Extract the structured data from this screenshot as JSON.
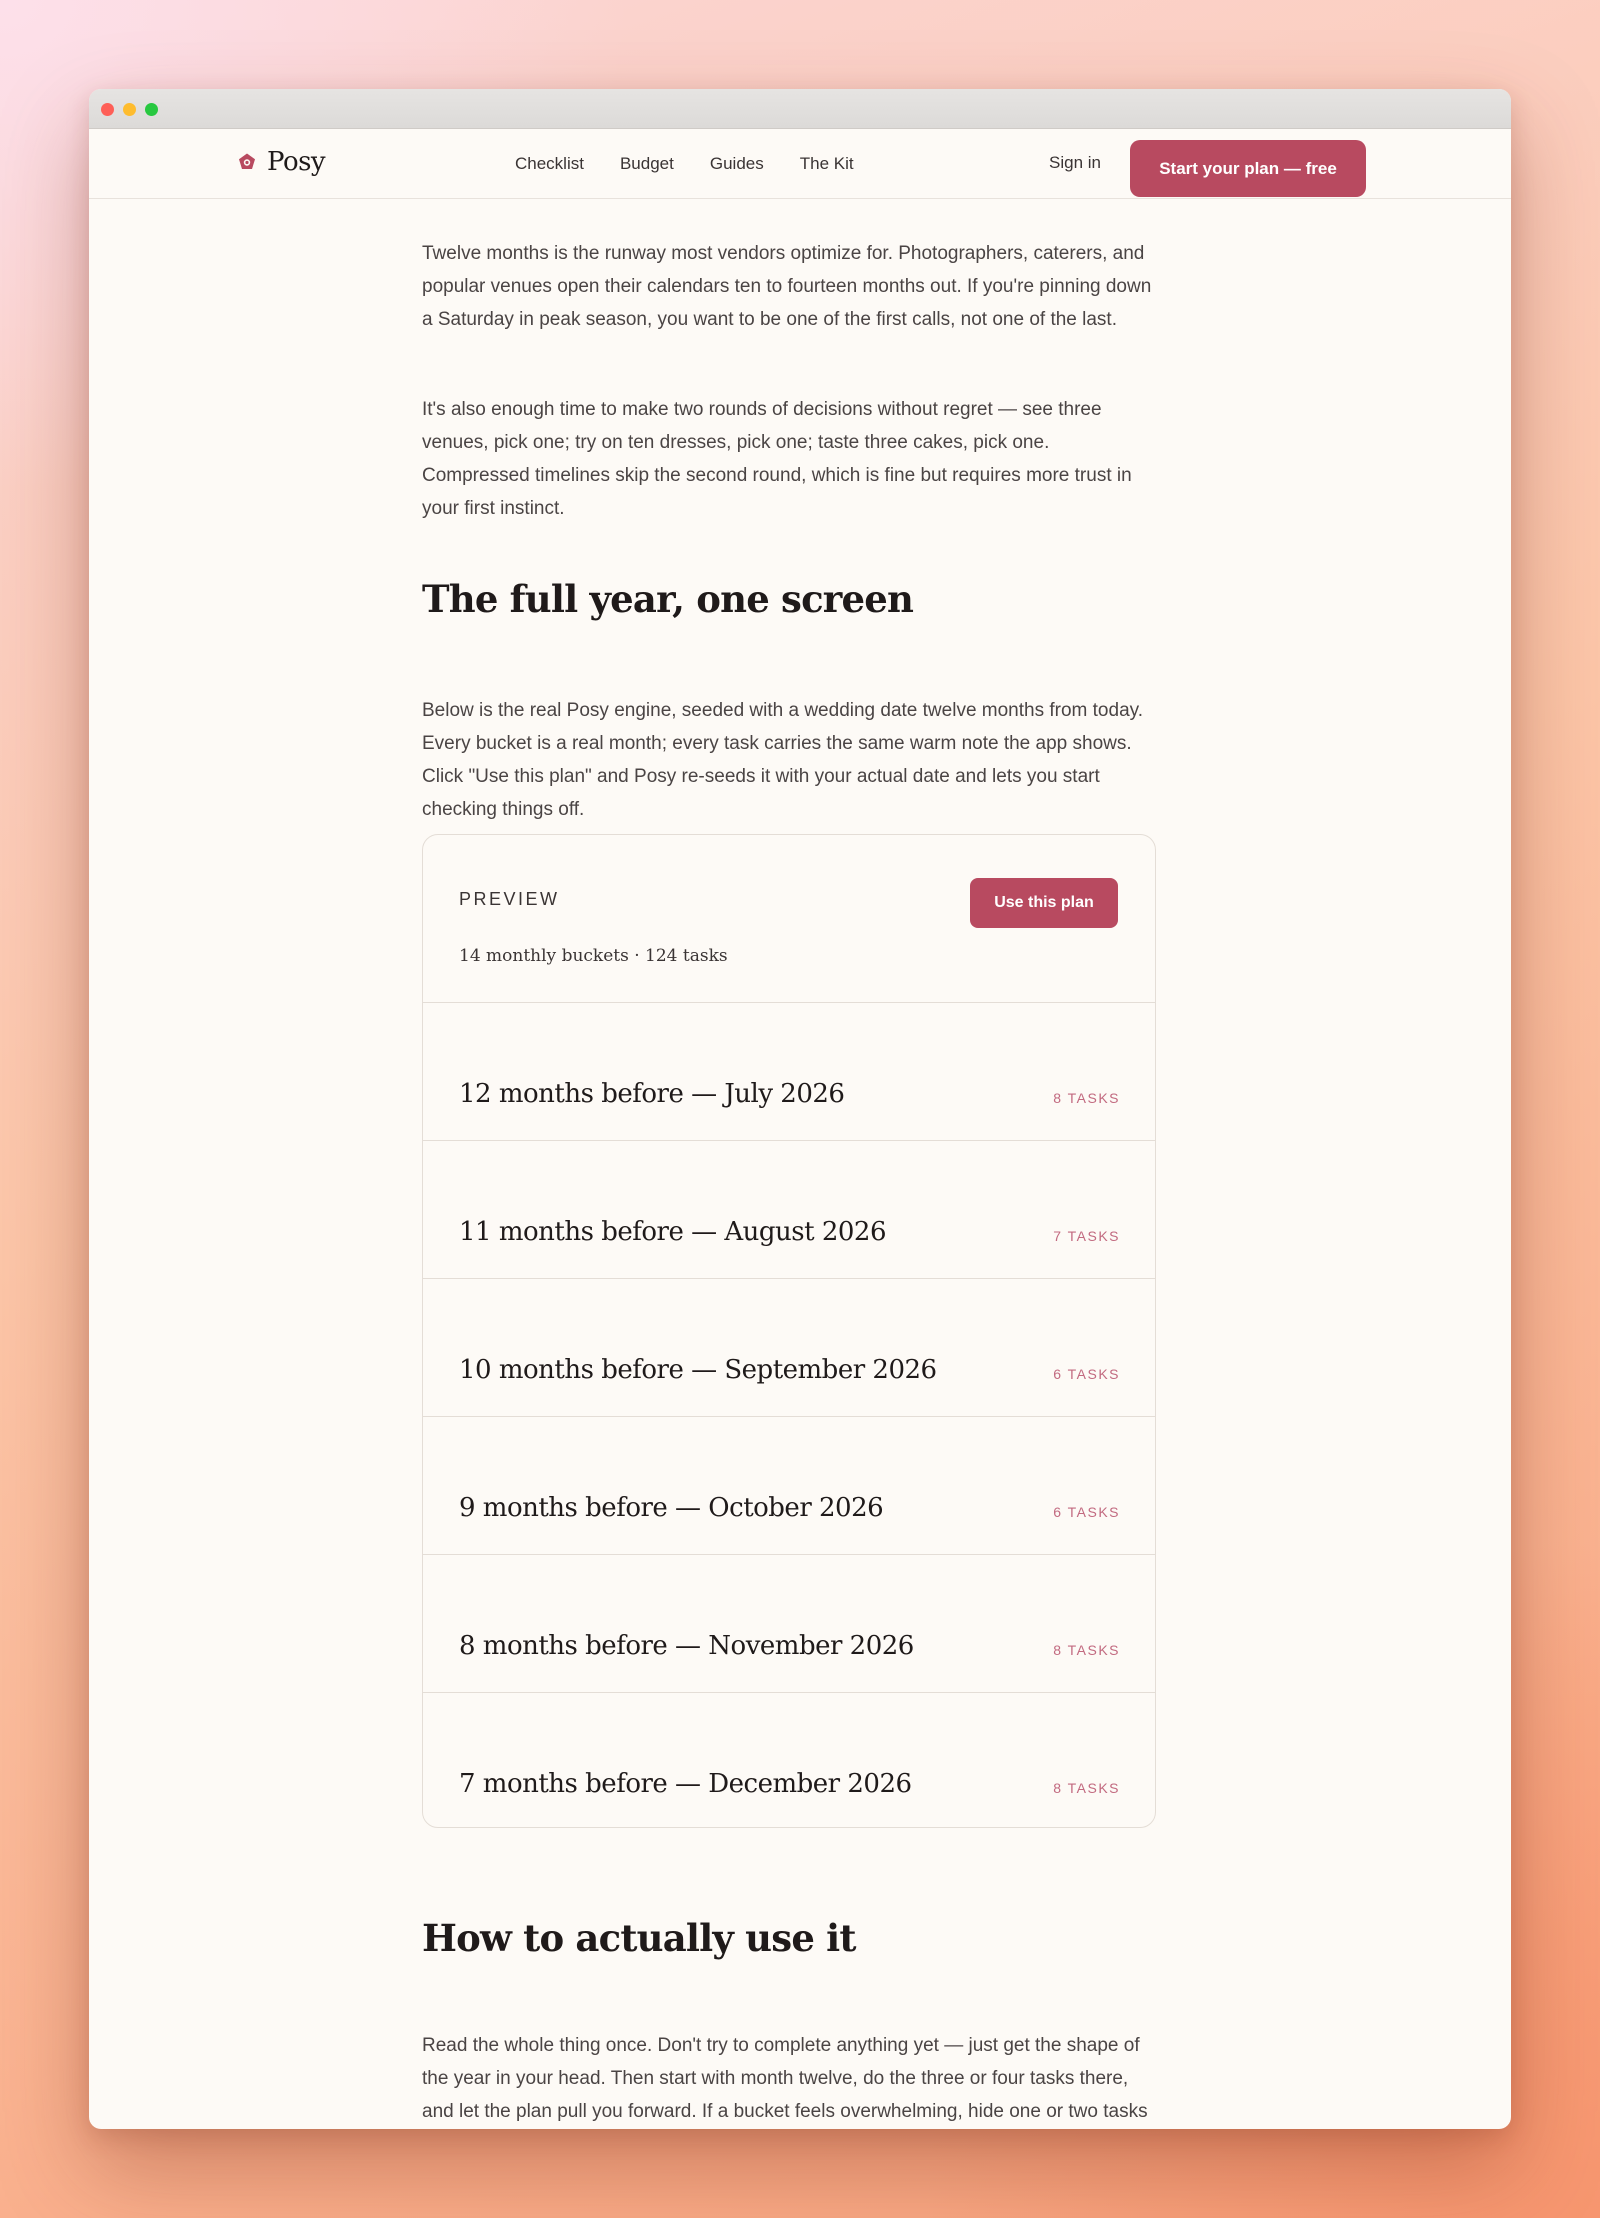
{
  "nav": {
    "brand": "Posy",
    "links": [
      "Checklist",
      "Budget",
      "Guides",
      "The Kit"
    ],
    "sign_in": "Sign in",
    "cta": "Start your plan — free"
  },
  "article": {
    "intro_p1": "Twelve months is the runway most vendors optimize for. Photographers, caterers, and popular venues open their calendars ten to fourteen months out. If you're pinning down a Saturday in peak season, you want to be one of the first calls, not one of the last.",
    "intro_p2": "It's also enough time to make two rounds of decisions without regret — see three venues, pick one; try on ten dresses, pick one; taste three cakes, pick one. Compressed timelines skip the second round, which is fine but requires more trust in your first instinct.",
    "section1_title": "The full year, one screen",
    "section1_p": "Below is the real Posy engine, seeded with a wedding date twelve months from today. Every bucket is a real month; every task carries the same warm note the app shows. Click \"Use this plan\" and Posy re-seeds it with your actual date and lets you start checking things off.",
    "section2_title": "How to actually use it",
    "section2_p": "Read the whole thing once. Don't try to complete anything yet — just get the shape of the year in your head. Then start with month twelve, do the three or four tasks there, and let the plan pull you forward. If a bucket feels overwhelming, hide one or two tasks — every wedding is different and the plan is yours to prune."
  },
  "preview": {
    "label": "PREVIEW",
    "button": "Use this plan",
    "stats": "14 monthly buckets · 124 tasks",
    "buckets": [
      {
        "title": "12 months before — July 2026",
        "count": "8 TASKS"
      },
      {
        "title": "11 months before — August 2026",
        "count": "7 TASKS"
      },
      {
        "title": "10 months before — September 2026",
        "count": "6 TASKS"
      },
      {
        "title": "9 months before — October 2026",
        "count": "6 TASKS"
      },
      {
        "title": "8 months before — November 2026",
        "count": "8 TASKS"
      },
      {
        "title": "7 months before — December 2026",
        "count": "8 TASKS"
      }
    ]
  },
  "colors": {
    "accent": "#b84a60",
    "task_count": "#c26a80",
    "page_bg": "#fdfaf6"
  }
}
